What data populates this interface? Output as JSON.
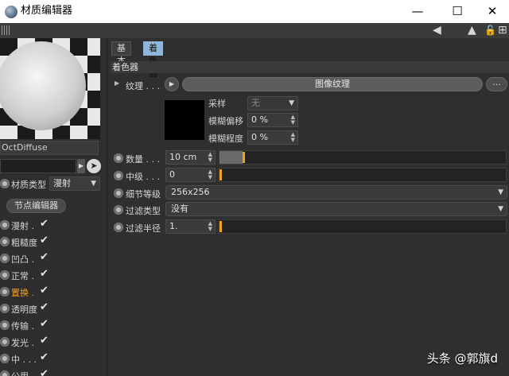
{
  "window": {
    "title": "材质编辑器",
    "minimize": "—",
    "maximize": "☐",
    "close": "✕"
  },
  "toolbar": {
    "back": "◀",
    "up": "▲",
    "lock": "🔓",
    "add": "⊞"
  },
  "left": {
    "material_name": "OctDiffuse",
    "material_type_label": "材质类型",
    "material_type_value": "漫射",
    "node_editor": "节点编辑器",
    "channels": [
      {
        "label": "漫射 .",
        "checked": "✔",
        "active": false
      },
      {
        "label": "粗糙度",
        "checked": "✔",
        "active": false
      },
      {
        "label": "凹凸 .",
        "checked": "✔",
        "active": false
      },
      {
        "label": "正常 .",
        "checked": "✔",
        "active": false
      },
      {
        "label": "置换 .",
        "checked": "✔",
        "active": true
      },
      {
        "label": "透明度",
        "checked": "✔",
        "active": false
      },
      {
        "label": "传输 .",
        "checked": "✔",
        "active": false
      },
      {
        "label": "发光 .",
        "checked": "✔",
        "active": false
      },
      {
        "label": "中 . . .",
        "checked": "✔",
        "active": false
      },
      {
        "label": "公用 .",
        "checked": "✔",
        "active": false
      }
    ]
  },
  "tabs": [
    {
      "label": "基本"
    },
    {
      "label": "着色器"
    }
  ],
  "section_title": "着色器",
  "texture": {
    "label": "纹理 . . .",
    "button": "图像纹理",
    "more": "...",
    "sampling_label": "采样",
    "sampling_value": "无",
    "blur_offset_label": "模糊偏移",
    "blur_offset_value": "0 %",
    "blur_degree_label": "模糊程度",
    "blur_degree_value": "0 %"
  },
  "params": {
    "amount_label": "数量 . . .",
    "amount_value": "10 cm",
    "amount_fraction": 0.08,
    "mid_label": "中级 . . .",
    "mid_value": "0",
    "mid_fraction": 0.0,
    "detail_label": "细节等级",
    "detail_value": "256x256",
    "filter_type_label": "过滤类型",
    "filter_type_value": "没有",
    "filter_radius_label": "过滤半径",
    "filter_radius_value": "1.",
    "filter_radius_fraction": 0.0
  },
  "watermark": "头条 @郭旗d",
  "colors": {
    "accent": "#f2a020",
    "tab_active": "#8fb6d8"
  }
}
